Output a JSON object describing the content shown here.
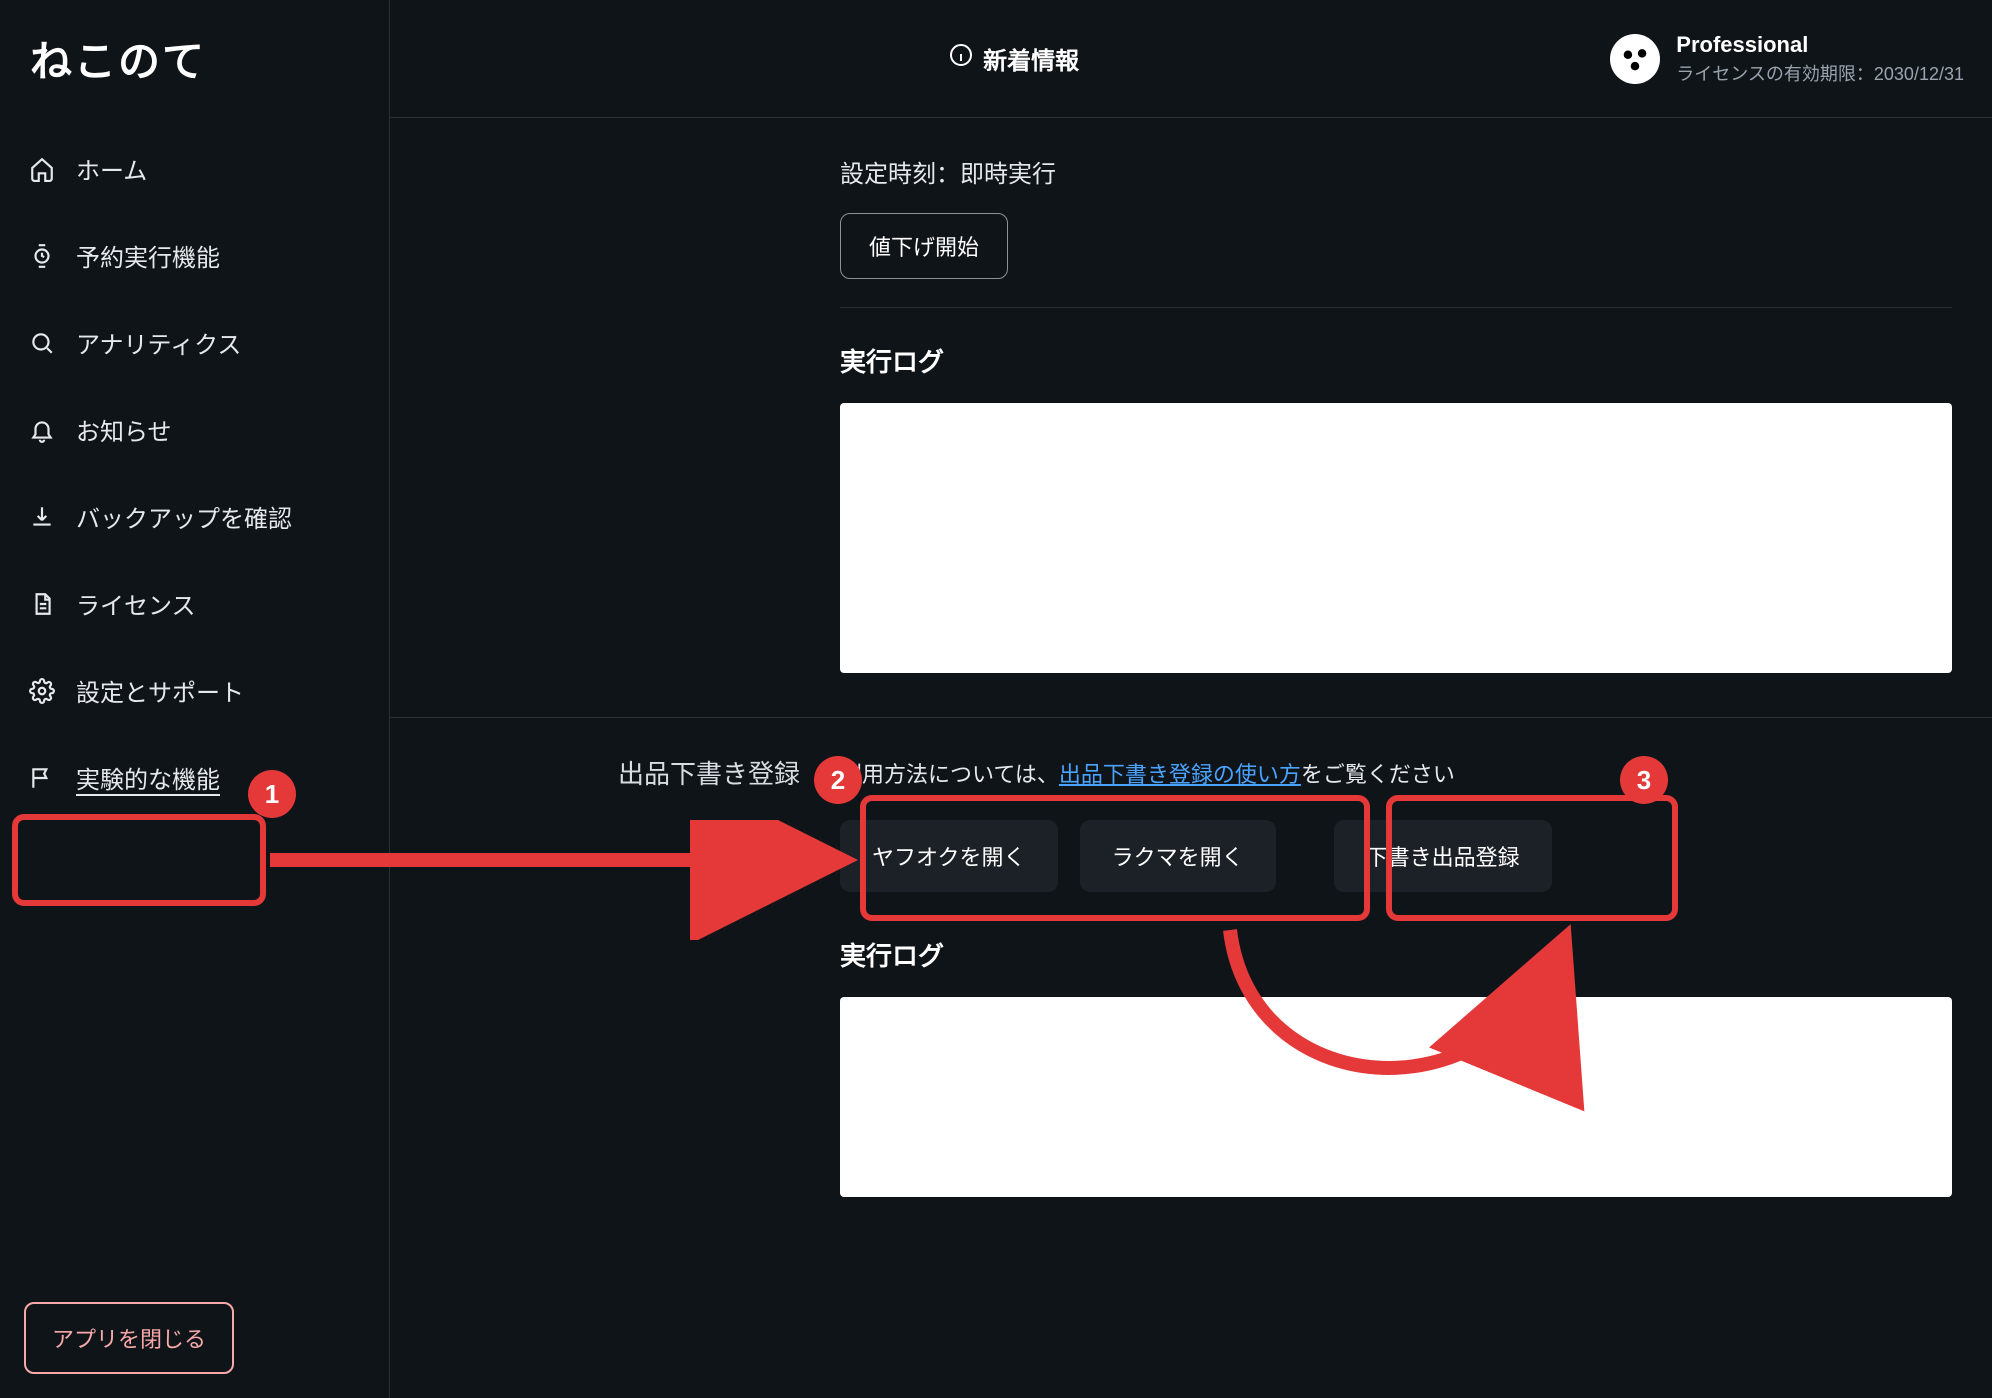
{
  "app_name": "ねこのて",
  "sidebar": {
    "items": [
      {
        "label": "ホーム",
        "icon": "home-icon"
      },
      {
        "label": "予約実行機能",
        "icon": "watch-icon"
      },
      {
        "label": "アナリティクス",
        "icon": "search-icon"
      },
      {
        "label": "お知らせ",
        "icon": "bell-icon"
      },
      {
        "label": "バックアップを確認",
        "icon": "download-icon"
      },
      {
        "label": "ライセンス",
        "icon": "document-icon"
      },
      {
        "label": "設定とサポート",
        "icon": "gear-icon"
      },
      {
        "label": "実験的な機能",
        "icon": "flag-icon",
        "active": true
      }
    ],
    "close_label": "アプリを閉じる"
  },
  "topbar": {
    "news_label": "新着情報",
    "plan_name": "Professional",
    "plan_expiry": "ライセンスの有効期限：2030/12/31"
  },
  "section_top": {
    "setting_time": "設定時刻：即時実行",
    "start_button": "値下げ開始",
    "log_heading": "実行ログ"
  },
  "section_draft": {
    "label": "出品下書き登録",
    "desc_prefix": "利用方法については、",
    "desc_link": "出品下書き登録の使い方",
    "desc_suffix": "をご覧ください",
    "buttons": {
      "yahoo": "ヤフオクを開く",
      "rakuma": "ラクマを開く",
      "register": "下書き出品登録"
    },
    "log_heading": "実行ログ"
  },
  "annotations": {
    "badge1": "1",
    "badge2": "2",
    "badge3": "3",
    "highlight_color": "#e53939"
  }
}
